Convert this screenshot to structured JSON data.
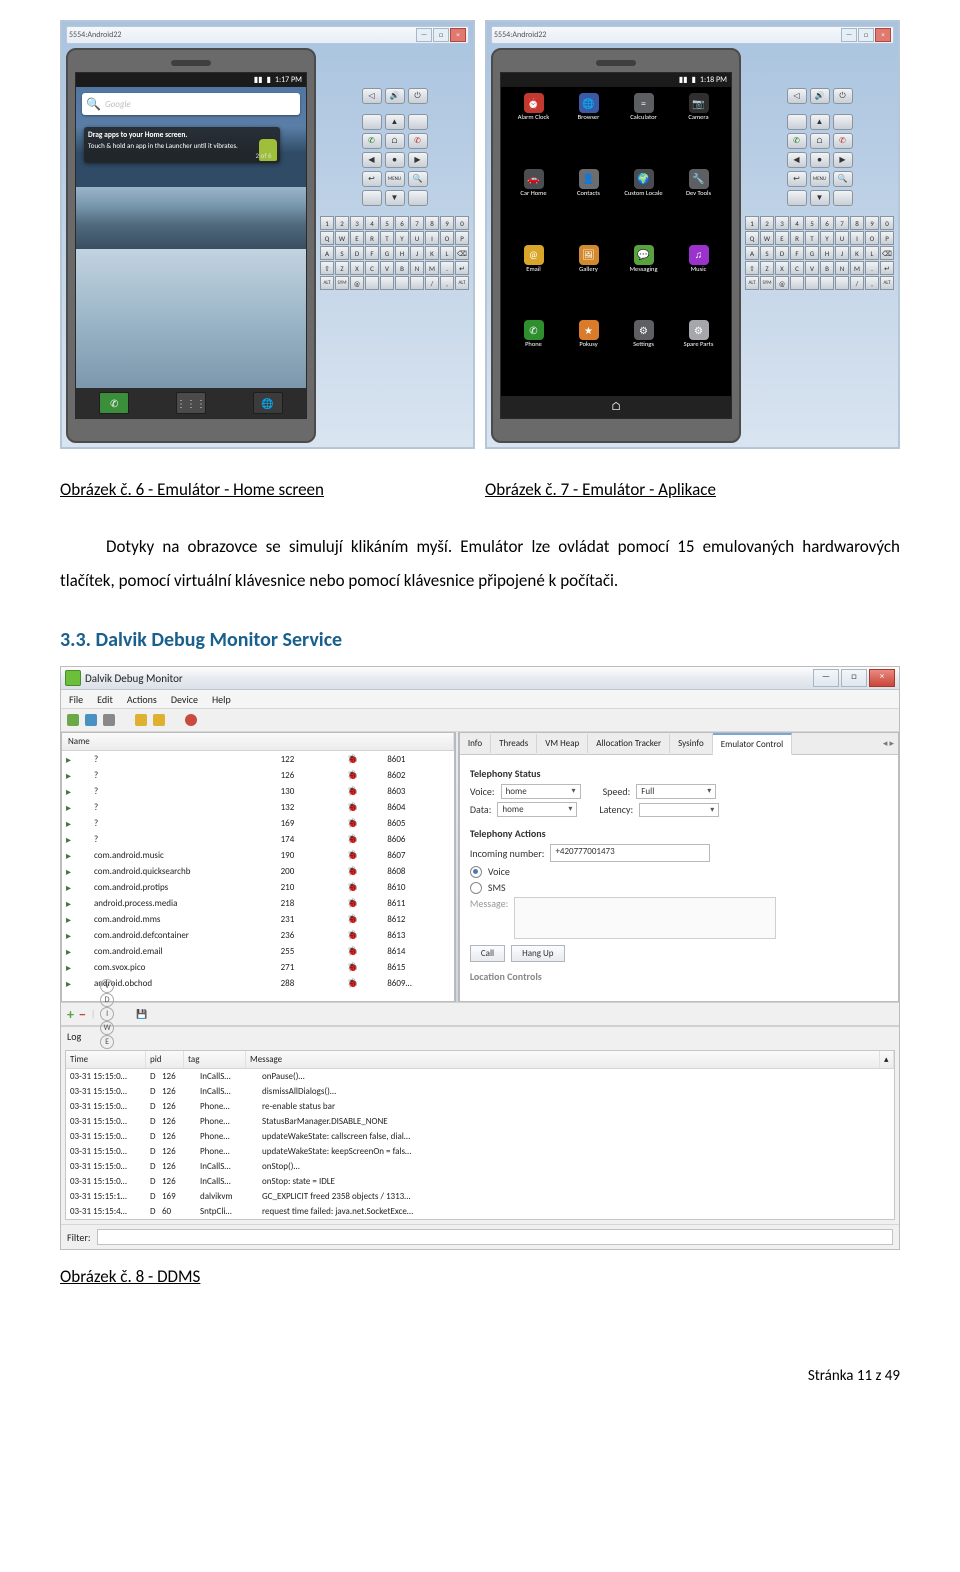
{
  "emu": {
    "window_title": "5554:Android22",
    "status_time_left": "1:17 PM",
    "status_time_right": "1:18 PM",
    "search_placeholder": "Google",
    "hint_title": "Drag apps to your Home screen.",
    "hint_body": "Touch & hold an app in the Launcher until it vibrates.",
    "hint_page": "2 of 6",
    "dpad_labels": [
      "◁",
      "▲",
      "▷",
      "◀",
      "●",
      "▶",
      "↺",
      "▼",
      "MENU"
    ],
    "phone_buttons": {
      "call": "✆",
      "home": "⌂",
      "menu": "MENU",
      "back": "↩",
      "end": "✆",
      "search": "🔍"
    },
    "keyboard": [
      [
        "1",
        "2",
        "3",
        "4",
        "5",
        "6",
        "7",
        "8",
        "9",
        "0"
      ],
      [
        "Q",
        "W",
        "E",
        "R",
        "T",
        "Y",
        "U",
        "I",
        "O",
        "P"
      ],
      [
        "A",
        "S",
        "D",
        "F",
        "G",
        "H",
        "J",
        "K",
        "L",
        "⌫"
      ],
      [
        "⇧",
        "Z",
        "X",
        "C",
        "V",
        "B",
        "N",
        "M",
        ".",
        "↵"
      ],
      [
        "ALT",
        "SYM",
        "@",
        "",
        "",
        "",
        "",
        "/",
        ",",
        "ALT"
      ]
    ],
    "apps": [
      {
        "label": "Alarm Clock",
        "color": "#c23a2f",
        "glyph": "⏰"
      },
      {
        "label": "Browser",
        "color": "#3a5aa3",
        "glyph": "🌐"
      },
      {
        "label": "Calculator",
        "color": "#5b5e63",
        "glyph": "="
      },
      {
        "label": "Camera",
        "color": "#2f2f2f",
        "glyph": "📷"
      },
      {
        "label": "Car Home",
        "color": "#4b4d50",
        "glyph": "🚗"
      },
      {
        "label": "Contacts",
        "color": "#6b6d70",
        "glyph": "👤"
      },
      {
        "label": "Custom Locale",
        "color": "#4a4c4f",
        "glyph": "🌍"
      },
      {
        "label": "Dev Tools",
        "color": "#5d5f62",
        "glyph": "🔧"
      },
      {
        "label": "Email",
        "color": "#d9a52a",
        "glyph": "@"
      },
      {
        "label": "Gallery",
        "color": "#d28a2f",
        "glyph": "🖼"
      },
      {
        "label": "Messaging",
        "color": "#5aa240",
        "glyph": "💬"
      },
      {
        "label": "Music",
        "color": "#9933cc",
        "glyph": "♫"
      },
      {
        "label": "Phone",
        "color": "#2f8f2f",
        "glyph": "✆"
      },
      {
        "label": "Pokusy",
        "color": "#d97b2a",
        "glyph": "★"
      },
      {
        "label": "Settings",
        "color": "#5d5f62",
        "glyph": "⚙"
      },
      {
        "label": "Spare Parts",
        "color": "#a5a7aa",
        "glyph": "⚙"
      }
    ]
  },
  "captions": {
    "c1": "Obrázek č. 6 - Emulátor - Home screen",
    "c2": "Obrázek č. 7 - Emulátor - Aplikace",
    "c3": "Obrázek č. 8 - DDMS"
  },
  "paragraph": "Dotyky na obrazovce se simulují klikáním myší. Emulátor lze ovládat pomocí 15 emulovaných hardwarových tlačítek, pomocí virtuální klávesnice nebo pomocí klávesnice připojené k počítači.",
  "heading": "3.3. Dalvik Debug Monitor Service",
  "ddms": {
    "title": "Dalvik Debug Monitor",
    "menu": [
      "File",
      "Edit",
      "Actions",
      "Device",
      "Help"
    ],
    "procHead": [
      "Name",
      "",
      "",
      ""
    ],
    "processes": [
      {
        "name": "?",
        "pid": "122",
        "port": "8601"
      },
      {
        "name": "?",
        "pid": "126",
        "port": "8602"
      },
      {
        "name": "?",
        "pid": "130",
        "port": "8603"
      },
      {
        "name": "?",
        "pid": "132",
        "port": "8604"
      },
      {
        "name": "?",
        "pid": "169",
        "port": "8605"
      },
      {
        "name": "?",
        "pid": "174",
        "port": "8606"
      },
      {
        "name": "com.android.music",
        "pid": "190",
        "port": "8607"
      },
      {
        "name": "com.android.quicksearchb",
        "pid": "200",
        "port": "8608"
      },
      {
        "name": "com.android.protips",
        "pid": "210",
        "port": "8610"
      },
      {
        "name": "android.process.media",
        "pid": "218",
        "port": "8611"
      },
      {
        "name": "com.android.mms",
        "pid": "231",
        "port": "8612"
      },
      {
        "name": "com.android.defcontainer",
        "pid": "236",
        "port": "8613"
      },
      {
        "name": "com.android.email",
        "pid": "255",
        "port": "8614"
      },
      {
        "name": "com.svox.pico",
        "pid": "271",
        "port": "8615"
      },
      {
        "name": "android.obchod",
        "pid": "288",
        "port": "8609…"
      }
    ],
    "tabs": [
      "Info",
      "Threads",
      "VM Heap",
      "Allocation Tracker",
      "Sysinfo",
      "Emulator Control"
    ],
    "activeTab": 5,
    "telephony": {
      "group1": "Telephony Status",
      "voiceLabel": "Voice:",
      "voiceVal": "home",
      "speedLabel": "Speed:",
      "speedVal": "Full",
      "dataLabel": "Data:",
      "dataVal": "home",
      "latencyLabel": "Latency:",
      "group2": "Telephony Actions",
      "incomingLabel": "Incoming number:",
      "incomingVal": "+420777001473",
      "optVoice": "Voice",
      "optSMS": "SMS",
      "msgLabel": "Message:",
      "btnCall": "Call",
      "btnHang": "Hang Up",
      "group3": "Location Controls"
    },
    "midIcons": [
      "V",
      "D",
      "I",
      "W",
      "E"
    ],
    "log": {
      "title": "Log",
      "head": [
        "Time",
        "pid",
        "tag",
        "Message"
      ],
      "rows": [
        {
          "t": "03-31 15:15:0…",
          "l": "D",
          "p": "126",
          "tag": "InCallS…",
          "m": "onPause()…"
        },
        {
          "t": "03-31 15:15:0…",
          "l": "D",
          "p": "126",
          "tag": "InCallS…",
          "m": "dismissAllDialogs()…"
        },
        {
          "t": "03-31 15:15:0…",
          "l": "D",
          "p": "126",
          "tag": "Phone…",
          "m": "re-enable status bar"
        },
        {
          "t": "03-31 15:15:0…",
          "l": "D",
          "p": "126",
          "tag": "Phone…",
          "m": "StatusBarManager.DISABLE_NONE"
        },
        {
          "t": "03-31 15:15:0…",
          "l": "D",
          "p": "126",
          "tag": "Phone…",
          "m": "updateWakeState: callscreen false, dial…"
        },
        {
          "t": "03-31 15:15:0…",
          "l": "D",
          "p": "126",
          "tag": "Phone…",
          "m": "updateWakeState: keepScreenOn = fals…"
        },
        {
          "t": "03-31 15:15:0…",
          "l": "D",
          "p": "126",
          "tag": "InCallS…",
          "m": "onStop()…"
        },
        {
          "t": "03-31 15:15:0…",
          "l": "D",
          "p": "126",
          "tag": "InCallS…",
          "m": "onStop: state = IDLE"
        },
        {
          "t": "03-31 15:15:1…",
          "l": "D",
          "p": "169",
          "tag": "dalvikvm",
          "m": "GC_EXPLICIT freed 2358 objects / 1313…"
        },
        {
          "t": "03-31 15:15:4…",
          "l": "D",
          "p": "60",
          "tag": "SntpCli…",
          "m": "request time failed: java.net.SocketExce…"
        }
      ],
      "filterLabel": "Filter:"
    }
  },
  "footer": "Stránka 11 z 49"
}
